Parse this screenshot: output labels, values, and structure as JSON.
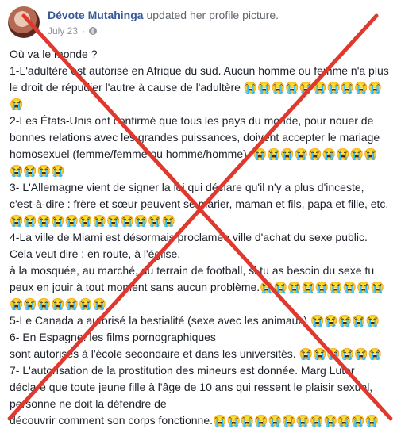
{
  "post": {
    "author": "Dévote Mutahinga",
    "action": "updated her profile picture.",
    "date": "July 23",
    "separator": "·",
    "paragraphs": [
      "Où va le monde ?",
      "1-L'adultère est autorisé en Afrique du sud. Aucun homme ou femme n'a plus le droit de répudier l'autre à cause de l'adultère 😭😭😭😭😭😭😭😭😭😭😭",
      "2-Les États-Unis ont confirmé que tous les pays du monde, pour nouer de bonnes relations avec les grandes puissances, doivent accepter le mariage homosexuel (femme/femme ou homme/homme). 😭😭😭😭😭😭😭😭😭😭😭😭😭",
      "3- L'Allemagne vient de signer la loi qui déclare qu'il n'y a plus d'inceste, c'est-à-dire : frère et sœur peuvent se marier, maman et fils, papa et fille, etc. 😭😭😭😭😭😭😭😭😭😭😭😭",
      "4-La ville de Miami est désormais proclamée ville d'achat du sexe public. Cela veut dire : en route, à l'église,\nà la mosquée, au marché, au terrain de football, si tu as besoin du sexe tu peux en jouir à tout moment sans aucun problème.😭😭😭😭😭😭😭😭😭😭😭😭😭😭😭😭",
      "5-Le Canada a autorisé la bestialité (sexe avec les animaux) 😭😭😭😭😭",
      "6- En Espagne: les films pornographiques\nsont autorisés à l'école secondaire et dans les universités. 😭😭😭😭😭😭",
      "7- L'autorisation de la prostitution des mineurs est donnée. Marg Luter déclare que toute jeune fille à l'âge de 10 ans qui ressent le plaisir sexuel, personne ne doit la défendre de\ndécouvrir comment son corps fonctionne.😭😭😭😭😭😭😭😭😭😭😭😭"
    ]
  },
  "overlay": {
    "color": "#e0382f"
  }
}
